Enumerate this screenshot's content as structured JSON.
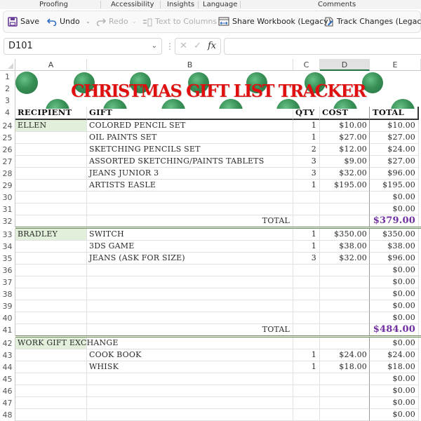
{
  "ribbon": {
    "groups": [
      "Proofing",
      "Accessibility",
      "Insights",
      "Language",
      "Comments"
    ]
  },
  "toolbar": {
    "save_label": "Save",
    "undo_label": "Undo",
    "redo_label": "Redo",
    "text_to_columns_label": "Text to Columns",
    "share_workbook_label": "Share Workbook (Legacy)",
    "track_changes_label": "Track Changes (Legacy)"
  },
  "formula_bar": {
    "name_box": "D101",
    "fx_label": "fx",
    "formula": ""
  },
  "columns": [
    "A",
    "B",
    "C",
    "D",
    "E"
  ],
  "selected_column": "D",
  "sheet": {
    "title": "CHRISTMAS GIFT LIST TRACKER",
    "title_color": "#e01010",
    "accent_total_color": "#7030a0",
    "recipient_fill": "#e2efda",
    "header_row": {
      "row": "4",
      "recipient": "RECIPIENT",
      "gift": "GIFT",
      "qty": "QTY",
      "cost": "COST",
      "total": "TOTAL"
    },
    "title_rows": [
      "1",
      "2",
      "3"
    ],
    "rows": [
      {
        "row": "24",
        "recipient": "ELLEN",
        "gift": "COLORED PENCIL SET",
        "qty": "1",
        "cost": "$10.00",
        "total": "$10.00"
      },
      {
        "row": "25",
        "recipient": "",
        "gift": "OIL PAINTS SET",
        "qty": "1",
        "cost": "$27.00",
        "total": "$27.00"
      },
      {
        "row": "26",
        "recipient": "",
        "gift": "SKETCHING PENCILS SET",
        "qty": "2",
        "cost": "$12.00",
        "total": "$24.00"
      },
      {
        "row": "27",
        "recipient": "",
        "gift": "ASSORTED SKETCHING/PAINTS TABLETS",
        "qty": "3",
        "cost": "$9.00",
        "total": "$27.00"
      },
      {
        "row": "28",
        "recipient": "",
        "gift": "JEANS JUNIOR 3",
        "qty": "3",
        "cost": "$32.00",
        "total": "$96.00"
      },
      {
        "row": "29",
        "recipient": "",
        "gift": "ARTISTS EASLE",
        "qty": "1",
        "cost": "$195.00",
        "total": "$195.00"
      },
      {
        "row": "30",
        "recipient": "",
        "gift": "",
        "qty": "",
        "cost": "",
        "total": "$0.00"
      },
      {
        "row": "31",
        "recipient": "",
        "gift": "",
        "qty": "",
        "cost": "",
        "total": "$0.00"
      },
      {
        "row": "32",
        "type": "total",
        "label": "TOTAL",
        "total": "$379.00"
      },
      {
        "row": "33",
        "recipient": "BRADLEY",
        "gift": "SWITCH",
        "qty": "1",
        "cost": "$350.00",
        "total": "$350.00"
      },
      {
        "row": "34",
        "recipient": "",
        "gift": "3DS GAME",
        "qty": "1",
        "cost": "$38.00",
        "total": "$38.00"
      },
      {
        "row": "35",
        "recipient": "",
        "gift": "JEANS (ASK FOR SIZE)",
        "qty": "3",
        "cost": "$32.00",
        "total": "$96.00"
      },
      {
        "row": "36",
        "recipient": "",
        "gift": "",
        "qty": "",
        "cost": "",
        "total": "$0.00"
      },
      {
        "row": "37",
        "recipient": "",
        "gift": "",
        "qty": "",
        "cost": "",
        "total": "$0.00"
      },
      {
        "row": "38",
        "recipient": "",
        "gift": "",
        "qty": "",
        "cost": "",
        "total": "$0.00"
      },
      {
        "row": "39",
        "recipient": "",
        "gift": "",
        "qty": "",
        "cost": "",
        "total": "$0.00"
      },
      {
        "row": "40",
        "recipient": "",
        "gift": "",
        "qty": "",
        "cost": "",
        "total": "$0.00"
      },
      {
        "row": "41",
        "type": "total",
        "label": "TOTAL",
        "total": "$484.00"
      },
      {
        "row": "42",
        "recipient": "WORK GIFT EXCHANGE",
        "gift": "",
        "qty": "",
        "cost": "",
        "total": "$0.00"
      },
      {
        "row": "43",
        "recipient": "",
        "gift": "COOK BOOK",
        "qty": "1",
        "cost": "$24.00",
        "total": "$24.00"
      },
      {
        "row": "44",
        "recipient": "",
        "gift": "WHISK",
        "qty": "1",
        "cost": "$18.00",
        "total": "$18.00"
      },
      {
        "row": "45",
        "recipient": "",
        "gift": "",
        "qty": "",
        "cost": "",
        "total": "$0.00"
      },
      {
        "row": "46",
        "recipient": "",
        "gift": "",
        "qty": "",
        "cost": "",
        "total": "$0.00"
      },
      {
        "row": "47",
        "recipient": "",
        "gift": "",
        "qty": "",
        "cost": "",
        "total": "$0.00"
      },
      {
        "row": "48",
        "recipient": "",
        "gift": "",
        "qty": "",
        "cost": "",
        "total": "$0.00"
      }
    ]
  }
}
